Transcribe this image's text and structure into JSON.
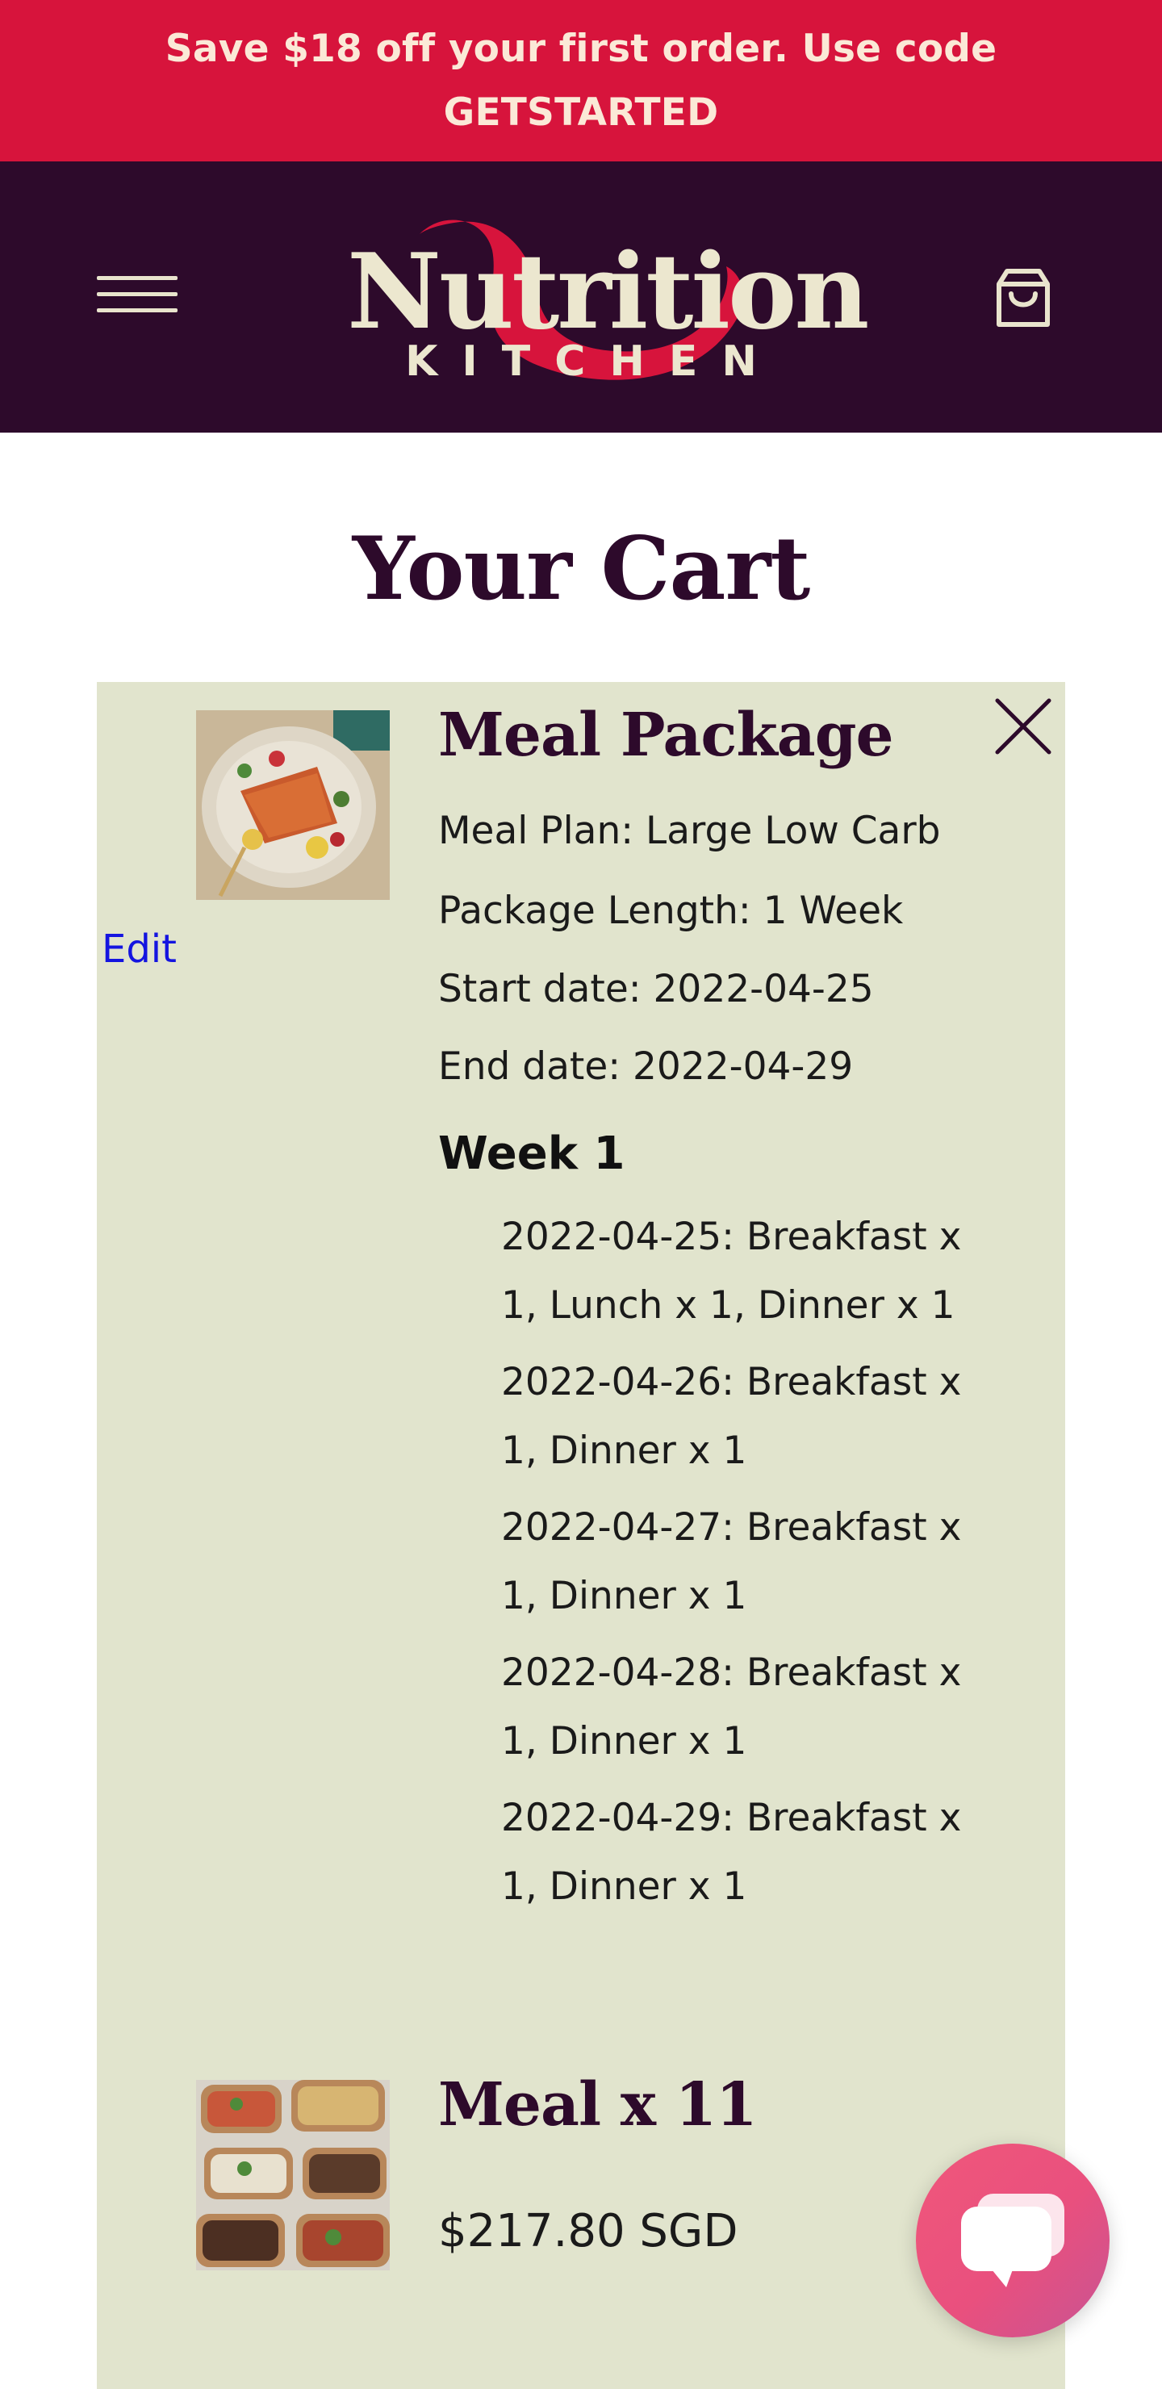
{
  "promo": {
    "text": "Save $18 off your first order. Use code GETSTARTED"
  },
  "header": {
    "logo_word": "Nutrition",
    "logo_sub": "KITCHEN",
    "menu_icon": "hamburger-menu-icon",
    "cart_icon": "shopping-bag-icon"
  },
  "page": {
    "title": "Your Cart"
  },
  "cart": {
    "items": [
      {
        "title": "Meal Package",
        "edit_label": "Edit",
        "details": [
          "Meal Plan: Large Low Carb",
          "Package Length: 1 Week",
          "Start date: 2022-04-25",
          "End date: 2022-04-29"
        ],
        "week_heading": "Week 1",
        "days": [
          "2022-04-25: Breakfast x 1, Lunch x 1, Dinner x 1",
          "2022-04-26: Breakfast x 1, Dinner x 1",
          "2022-04-27: Breakfast x 1, Dinner x 1",
          "2022-04-28: Breakfast x 1, Dinner x 1",
          "2022-04-29: Breakfast x 1, Dinner x 1"
        ]
      },
      {
        "title": "Meal x 11",
        "price": "$217.80 SGD"
      }
    ],
    "remove_icon": "close-icon"
  },
  "chat": {
    "icon": "chat-bubble-icon"
  },
  "colors": {
    "promo_bg": "#d7143c",
    "header_bg": "#2d0a2b",
    "panel_bg": "#e1e4cd",
    "cream": "#ece7cf",
    "link": "#1414e0"
  }
}
